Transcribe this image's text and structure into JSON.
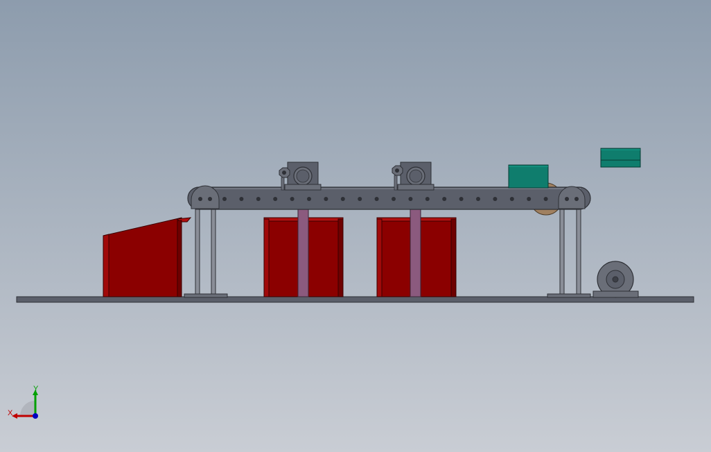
{
  "colors": {
    "background_top": "#8d9cad",
    "background_bottom": "#c9cdd4",
    "steel": "#5b5f6a",
    "steel_dark": "#3c3f46",
    "steel_light": "#8a8e98",
    "bin_red": "#8b0000",
    "bin_red_light": "#b01010",
    "bin_edge": "#3a0000",
    "post_violet": "#8b5a7e",
    "teal": "#0f7d6d",
    "teal_light": "#14a08c",
    "bronze": "#a08060",
    "x_axis": "#c00000",
    "y_axis": "#00a000",
    "z_axis": "#0000c0"
  },
  "triad": {
    "x_label": "X",
    "y_label": "Y"
  }
}
